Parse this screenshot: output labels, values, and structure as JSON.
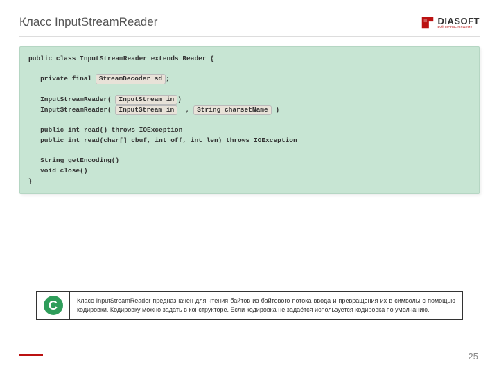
{
  "header": {
    "title": "Класс InputStreamReader",
    "logo": {
      "name": "DIASOFT",
      "tagline": "всё по-настоящему"
    }
  },
  "code": {
    "l1": "public class InputStreamReader extends Reader {",
    "l2a": "   private final ",
    "l2_hl": "StreamDecoder sd",
    "l2b": ";",
    "l3a": "   InputStreamReader( ",
    "l3_hl": "InputStream in",
    "l3b": ")",
    "l4a": "   InputStreamReader( ",
    "l4_hl1": "InputStream in",
    "l4m": "  , ",
    "l4_hl2": "String charsetName",
    "l4b": " )",
    "l5": "   public int read() throws IOException",
    "l6": "   public int read(char[] cbuf, int off, int len) throws IOException",
    "l7": "   String getEncoding()",
    "l8": "   void close()",
    "l9": "}"
  },
  "note": {
    "icon_letter": "C",
    "text": "Класс InputStreamReader предназначен для чтения байтов из байтового потока ввода и превращения их в символы с помощью кодировки. Кодировку можно задать в конструкторе. Если кодировка не задаётся используется кодировка по умолчанию."
  },
  "page_number": "25"
}
